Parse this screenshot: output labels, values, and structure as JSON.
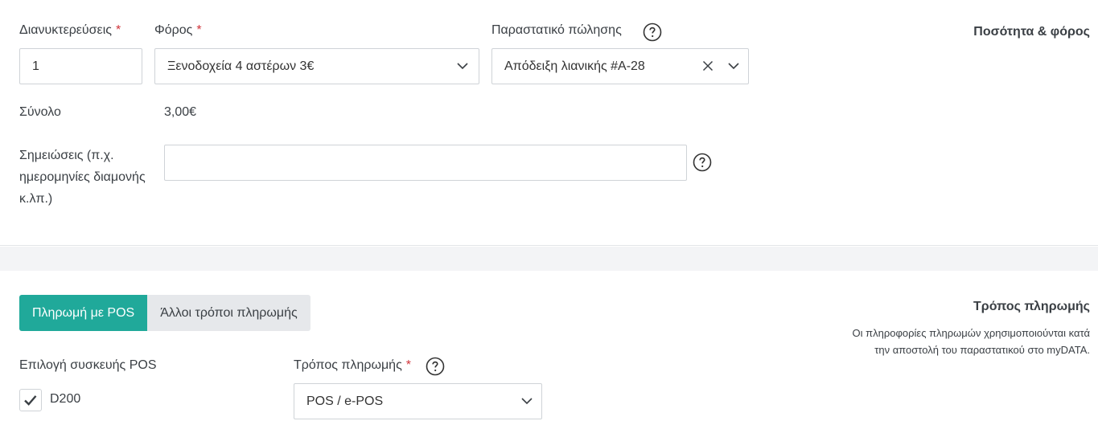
{
  "quantity_section": {
    "title": "Ποσότητα & φόρος",
    "nights": {
      "label": "Διανυκτερεύσεις",
      "required_mark": "*",
      "value": "1"
    },
    "tax": {
      "label": "Φόρος",
      "required_mark": "*",
      "value": "Ξενοδοχεία 4 αστέρων 3€"
    },
    "receipt": {
      "label": "Παραστατικό πώλησης",
      "value": "Απόδειξη λιανικής #A-28"
    },
    "total": {
      "label": "Σύνολο",
      "value": "3,00€"
    },
    "notes": {
      "label": "Σημειώσεις (π.χ. ημερομηνίες διαμονής κ.λπ.)",
      "value": ""
    }
  },
  "payment_section": {
    "title": "Τρόπος πληρωμής",
    "description": "Οι πληροφορίες πληρωμών χρησιμοποιούνται κατά την αποστολή του παραστατικού στο myDATA.",
    "tabs": [
      {
        "label": "Πληρωμή με POS",
        "active": true
      },
      {
        "label": "Άλλοι τρόποι πληρωμής",
        "active": false
      }
    ],
    "pos_device": {
      "label": "Επιλογή συσκευής POS",
      "option_label": "D200",
      "checked": true
    },
    "payment_method": {
      "label": "Τρόπος πληρωμής",
      "required_mark": "*",
      "value": "POS / e-POS"
    }
  },
  "colors": {
    "accent": "#20a99a",
    "required": "#d0343a",
    "band": "#f3f4f6"
  }
}
